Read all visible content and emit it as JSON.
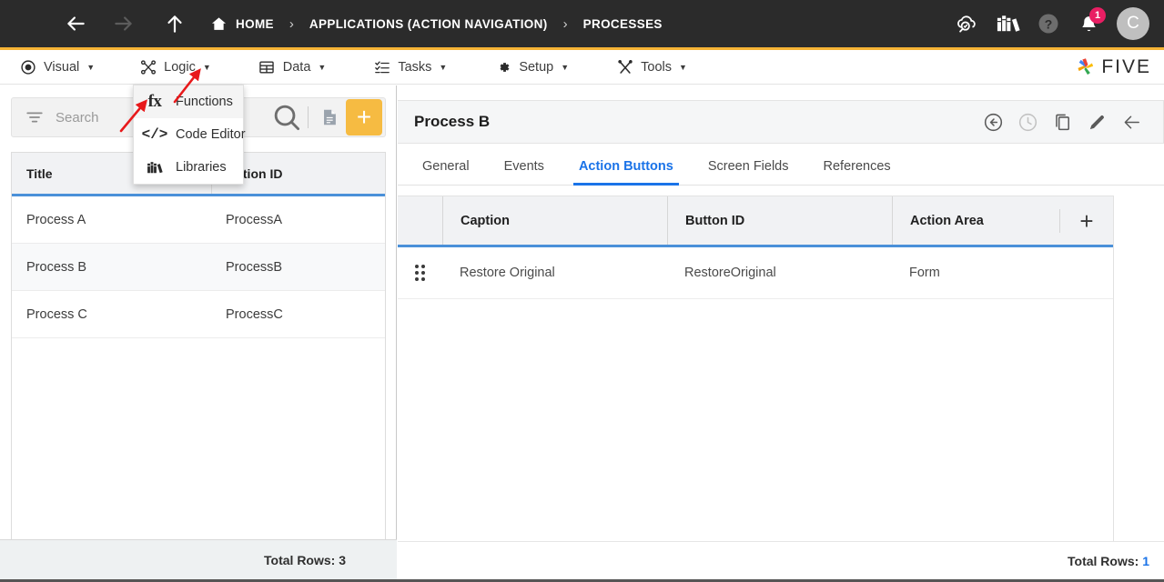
{
  "topbar": {
    "menu_icon": "hamburger-icon",
    "back_icon": "arrow-left-icon",
    "forward_icon": "arrow-right-icon",
    "up_icon": "arrow-up-icon",
    "home_label": "HOME",
    "separator": "›",
    "breadcrumb": [
      {
        "label": "APPLICATIONS (ACTION NAVIGATION)"
      },
      {
        "label": "PROCESSES"
      }
    ],
    "right_icons": [
      {
        "name": "cloud-search-icon"
      },
      {
        "name": "books-icon"
      },
      {
        "name": "help-icon"
      },
      {
        "name": "notifications-icon"
      }
    ],
    "notification_count": "1",
    "avatar_initial": "C",
    "accent_color": "#f5b335"
  },
  "menubar": {
    "items": [
      {
        "label": "Visual",
        "icon": "eye-icon",
        "caret": "▼"
      },
      {
        "label": "Logic",
        "icon": "logic-nodes-icon",
        "caret": "▼"
      },
      {
        "label": "Data",
        "icon": "table-icon",
        "caret": "▼"
      },
      {
        "label": "Tasks",
        "icon": "checklist-icon",
        "caret": "▼"
      },
      {
        "label": "Setup",
        "icon": "gear-icon",
        "caret": "▼"
      },
      {
        "label": "Tools",
        "icon": "tools-icon",
        "caret": "▼"
      }
    ],
    "brand": "FIVE"
  },
  "dropdown": {
    "open_for": "Logic",
    "items": [
      {
        "label": "Functions",
        "icon": "fx-icon",
        "active": true
      },
      {
        "label": "Code Editor",
        "icon": "code-brackets-icon",
        "active": false
      },
      {
        "label": "Libraries",
        "icon": "books-icon",
        "active": false
      }
    ]
  },
  "left_panel": {
    "search": {
      "placeholder": "Search",
      "value": "",
      "filter_icon": "filter-icon"
    },
    "toolbar": [
      {
        "name": "search-button",
        "icon": "search-icon"
      },
      {
        "name": "document-button",
        "icon": "document-icon"
      },
      {
        "name": "add-button",
        "icon": "plus-icon",
        "color": "#f6bb42"
      }
    ],
    "grid": {
      "columns": [
        "Title",
        "Action ID"
      ],
      "rows": [
        {
          "title": "Process A",
          "action_id": "ProcessA"
        },
        {
          "title": "Process B",
          "action_id": "ProcessB"
        },
        {
          "title": "Process C",
          "action_id": "ProcessC"
        }
      ]
    },
    "footer": {
      "total_rows_label": "Total Rows: 3"
    }
  },
  "right_panel": {
    "title": "Process B",
    "header_actions": [
      {
        "name": "back-circle-icon"
      },
      {
        "name": "history-clock-icon",
        "disabled": true
      },
      {
        "name": "copy-icon"
      },
      {
        "name": "edit-pencil-icon"
      },
      {
        "name": "close-arrow-icon"
      }
    ],
    "tabs": [
      {
        "label": "General",
        "selected": false
      },
      {
        "label": "Events",
        "selected": false
      },
      {
        "label": "Action Buttons",
        "selected": true
      },
      {
        "label": "Screen Fields",
        "selected": false
      },
      {
        "label": "References",
        "selected": false
      }
    ],
    "grid": {
      "columns": [
        "Caption",
        "Button ID",
        "Action Area"
      ],
      "add_icon": "plus-icon",
      "rows": [
        {
          "drag": "drag-handle-icon",
          "caption": "Restore Original",
          "button_id": "RestoreOriginal",
          "action_area": "Form"
        }
      ]
    },
    "footer": {
      "total_rows_prefix": "Total Rows: ",
      "total_rows_value": "1"
    }
  },
  "annotations": {
    "color": "#e8191b",
    "arrows": [
      {
        "name": "arrow-pointing-to-logic-caret"
      },
      {
        "name": "arrow-pointing-to-functions-item"
      }
    ]
  }
}
